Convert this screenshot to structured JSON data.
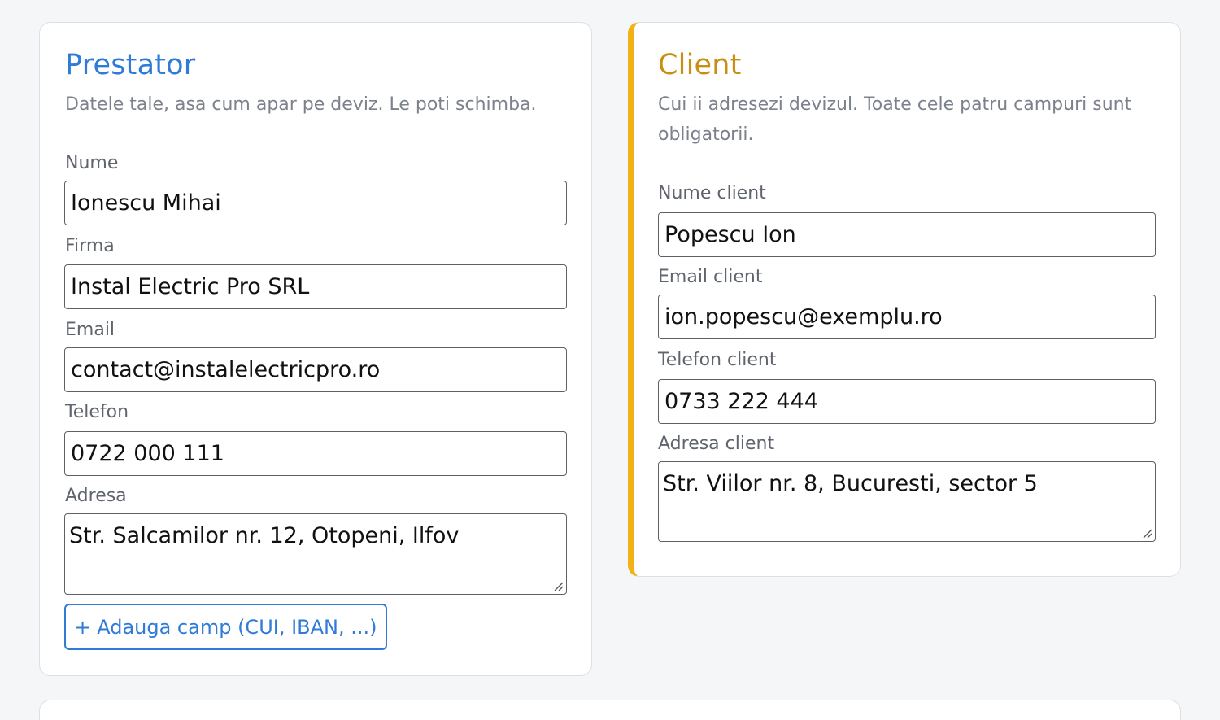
{
  "colors": {
    "prestator_title": "#2f7bd6",
    "client_title": "#c98f12",
    "client_accent": "#f2b216",
    "button": "#2f7bd6"
  },
  "prestator": {
    "title": "Prestator",
    "description": "Datele tale, asa cum apar pe deviz. Le poti schimba.",
    "fields": {
      "nume": {
        "label": "Nume",
        "value": "Ionescu Mihai"
      },
      "firma": {
        "label": "Firma",
        "value": "Instal Electric Pro SRL"
      },
      "email": {
        "label": "Email",
        "value": "contact@instalelectricpro.ro"
      },
      "telefon": {
        "label": "Telefon",
        "value": "0722 000 111"
      },
      "adresa": {
        "label": "Adresa",
        "value": "Str. Salcamilor nr. 12, Otopeni, Ilfov"
      }
    },
    "add_field_button": "+ Adauga camp (CUI, IBAN, ...)"
  },
  "client": {
    "title": "Client",
    "description_line1": "Cui ii adresezi devizul. Toate cele patru campuri sunt",
    "description_line2": "obligatorii.",
    "fields": {
      "nume": {
        "label": "Nume client",
        "value": "Popescu Ion"
      },
      "email": {
        "label": "Email client",
        "value": "ion.popescu@exemplu.ro"
      },
      "telefon": {
        "label": "Telefon client",
        "value": "0733 222 444"
      },
      "adresa": {
        "label": "Adresa client",
        "value": "Str. Viilor nr. 8, Bucuresti, sector 5"
      }
    }
  }
}
